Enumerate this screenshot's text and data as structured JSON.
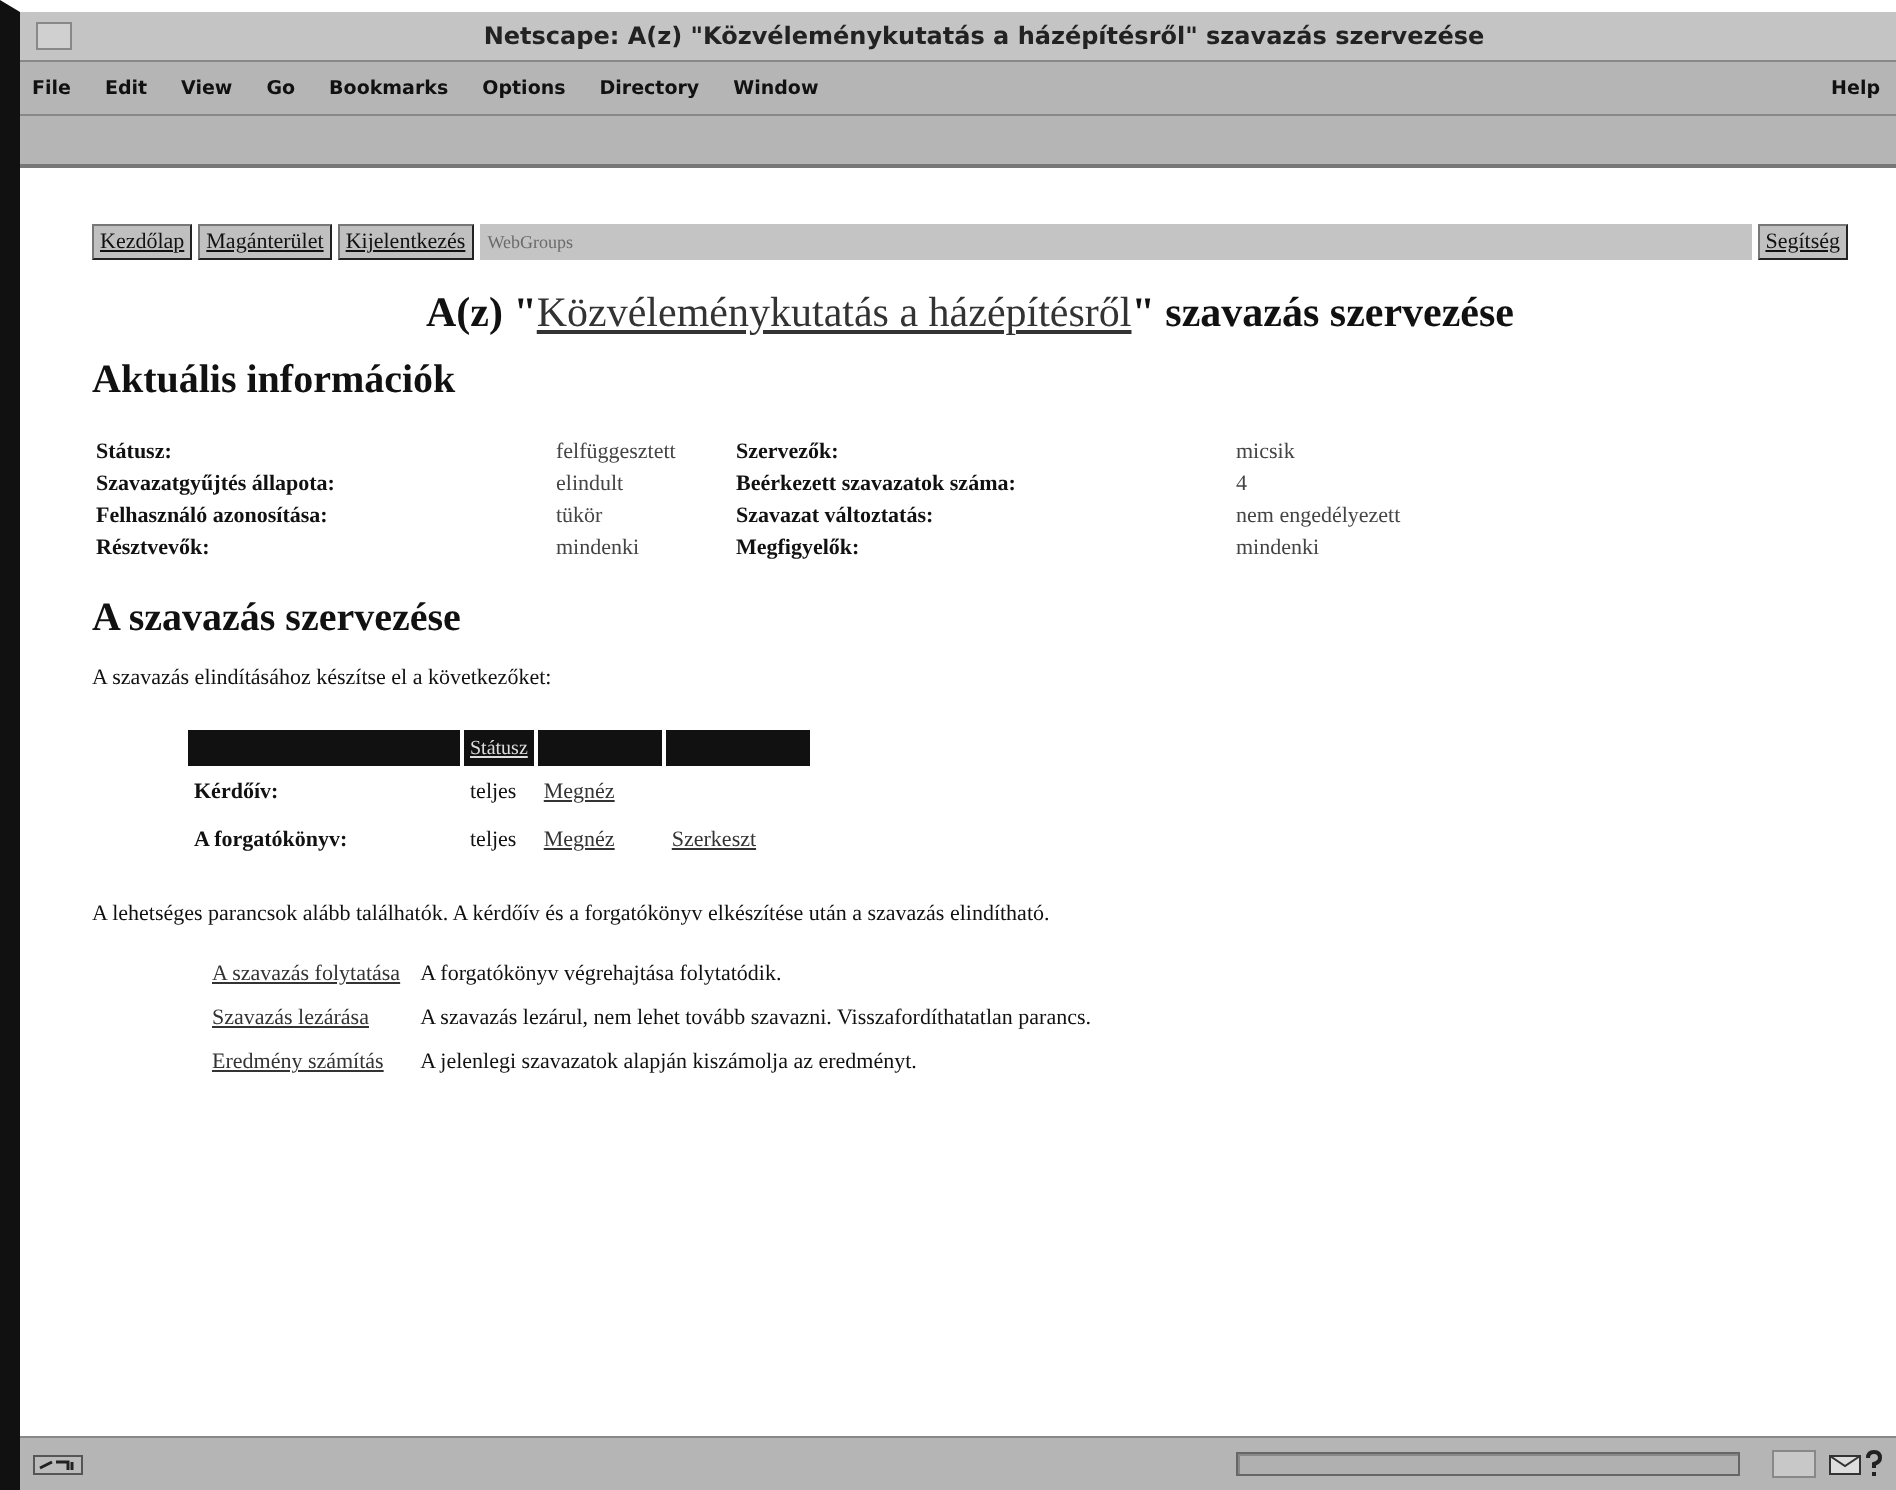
{
  "window": {
    "title": "Netscape: A(z) \"Közvéleménykutatás a házépítésről\" szavazás szervezése"
  },
  "menu": [
    "File",
    "Edit",
    "View",
    "Go",
    "Bookmarks",
    "Options",
    "Directory",
    "Window"
  ],
  "help_menu": "Help",
  "nav": {
    "buttons": [
      "Kezdőlap",
      "Magánterület",
      "Kijelentkezés"
    ],
    "banner": "WebGroups",
    "help": "Segítség"
  },
  "page_title": {
    "before": "A(z) \"",
    "link": "Közvéleménykutatás a házépítésről",
    "after": "\" szavazás szervezése"
  },
  "info_heading": "Aktuális információk",
  "info_rows": [
    {
      "label": "Státusz:",
      "value": "felfüggesztett",
      "label_2": "Szervezők:",
      "value_2": "micsik"
    },
    {
      "label": "Szavazatgyűjtés állapota:",
      "value": "elindult",
      "label_2": "Beérkezett szavazatok száma:",
      "value_2": "4"
    },
    {
      "label": "Felhasználó azonosítása:",
      "value": "tükör",
      "label_2": "Szavazat változtatás:",
      "value_2": "nem engedélyezett"
    },
    {
      "label": "Résztvevők:",
      "value": "mindenki",
      "label_2": "Megfigyelők:",
      "value_2": "mindenki"
    }
  ],
  "org_heading": "A szavazás szervezése",
  "org_intro": "A szavazás elindításához készítse el a következőket:",
  "prep_table": {
    "columns": [
      "Státusz"
    ],
    "rows": [
      {
        "name": "Kérdőív:",
        "status": "teljes",
        "links": [
          "Megnéz"
        ]
      },
      {
        "name": "A forgatókönyv:",
        "status": "teljes",
        "links": [
          "Megnéz",
          "Szerkeszt"
        ]
      }
    ]
  },
  "commands_intro": "A lehetséges parancsok alább találhatók. A kérdőív és a forgatókönyv elkészítése után a szavazás elindítható.",
  "commands": [
    {
      "link": "A szavazás folytatása",
      "description": "A forgatókönyv végrehajtása folytatódik."
    },
    {
      "link": "Szavazás lezárása",
      "description": "A szavazás lezárul, nem lehet tovább szavazni. Visszafordíthatatlan parancs."
    },
    {
      "link": "Eredmény számítás",
      "description": "A jelenlegi szavazatok alapján kiszámolja az eredményt."
    }
  ]
}
